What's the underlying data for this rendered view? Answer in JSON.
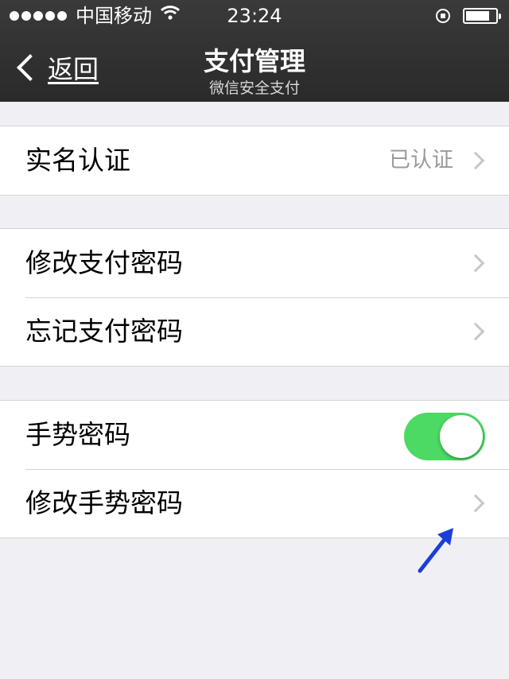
{
  "status_bar": {
    "carrier": "中国移动",
    "time": "23:24",
    "wifi_icon": "wifi-icon",
    "rotation_lock_icon": "rotation-lock-icon",
    "battery_level": 0.8
  },
  "nav": {
    "back_label": "返回",
    "title": "支付管理",
    "subtitle": "微信安全支付"
  },
  "groups": {
    "verification": {
      "label": "实名认证",
      "value": "已认证"
    },
    "password": {
      "change_label": "修改支付密码",
      "forgot_label": "忘记支付密码"
    },
    "gesture": {
      "gesture_label": "手势密码",
      "gesture_enabled": true,
      "change_gesture_label": "修改手势密码"
    }
  },
  "colors": {
    "nav_background": "#2f2f2f",
    "toggle_on": "#4cd964",
    "page_background": "#efeff4",
    "annotation_arrow": "#1a3fd6"
  }
}
